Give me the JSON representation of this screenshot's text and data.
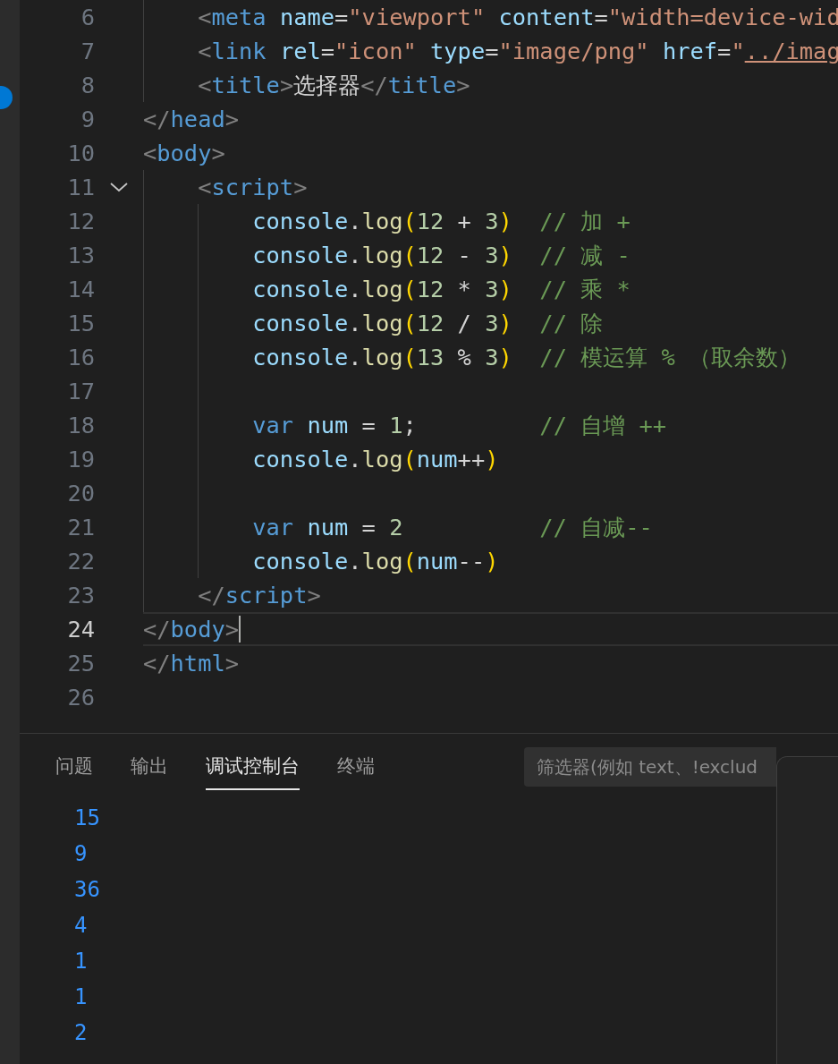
{
  "editor": {
    "lines": [
      {
        "number": "6",
        "selected": false,
        "tokens": [
          {
            "text": "    <",
            "kind": "punct"
          },
          {
            "text": "meta",
            "kind": "tag"
          },
          {
            "text": " name",
            "kind": "attr"
          },
          {
            "text": "=",
            "kind": "text"
          },
          {
            "text": "\"viewport\"",
            "kind": "string"
          },
          {
            "text": " content",
            "kind": "attr"
          },
          {
            "text": "=",
            "kind": "text"
          },
          {
            "text": "\"width=device-wid",
            "kind": "string"
          }
        ]
      },
      {
        "number": "7",
        "selected": false,
        "tokens": [
          {
            "text": "    <",
            "kind": "punct"
          },
          {
            "text": "link",
            "kind": "tag"
          },
          {
            "text": " rel",
            "kind": "attr"
          },
          {
            "text": "=",
            "kind": "text"
          },
          {
            "text": "\"icon\"",
            "kind": "string"
          },
          {
            "text": " type",
            "kind": "attr"
          },
          {
            "text": "=",
            "kind": "text"
          },
          {
            "text": "\"image/png\"",
            "kind": "string"
          },
          {
            "text": " href",
            "kind": "attr"
          },
          {
            "text": "=",
            "kind": "text"
          },
          {
            "text": "\"",
            "kind": "string"
          },
          {
            "text": "../imag",
            "kind": "link"
          }
        ]
      },
      {
        "number": "8",
        "selected": false,
        "tokens": [
          {
            "text": "    <",
            "kind": "punct"
          },
          {
            "text": "title",
            "kind": "tag"
          },
          {
            "text": ">",
            "kind": "punct"
          },
          {
            "text": "选择器",
            "kind": "text"
          },
          {
            "text": "</",
            "kind": "punct"
          },
          {
            "text": "title",
            "kind": "tag"
          },
          {
            "text": ">",
            "kind": "punct"
          }
        ]
      },
      {
        "number": "9",
        "selected": false,
        "tokens": [
          {
            "text": "</",
            "kind": "punct"
          },
          {
            "text": "head",
            "kind": "tag"
          },
          {
            "text": ">",
            "kind": "punct"
          }
        ]
      },
      {
        "number": "10",
        "selected": false,
        "tokens": [
          {
            "text": "<",
            "kind": "punct"
          },
          {
            "text": "body",
            "kind": "tag"
          },
          {
            "text": ">",
            "kind": "punct"
          }
        ]
      },
      {
        "number": "11",
        "selected": false,
        "expanded": true,
        "tokens": [
          {
            "text": "    <",
            "kind": "punct"
          },
          {
            "text": "script",
            "kind": "tag"
          },
          {
            "text": ">",
            "kind": "punct"
          }
        ]
      },
      {
        "number": "12",
        "selected": false,
        "tokens": [
          {
            "text": "        console",
            "kind": "var"
          },
          {
            "text": ".",
            "kind": "text"
          },
          {
            "text": "log",
            "kind": "func"
          },
          {
            "text": "(",
            "kind": "paren"
          },
          {
            "text": "12",
            "kind": "number"
          },
          {
            "text": " + ",
            "kind": "text"
          },
          {
            "text": "3",
            "kind": "number"
          },
          {
            "text": ")",
            "kind": "paren"
          },
          {
            "text": "  // 加 +",
            "kind": "comment"
          }
        ]
      },
      {
        "number": "13",
        "selected": false,
        "tokens": [
          {
            "text": "        console",
            "kind": "var"
          },
          {
            "text": ".",
            "kind": "text"
          },
          {
            "text": "log",
            "kind": "func"
          },
          {
            "text": "(",
            "kind": "paren"
          },
          {
            "text": "12",
            "kind": "number"
          },
          {
            "text": " - ",
            "kind": "text"
          },
          {
            "text": "3",
            "kind": "number"
          },
          {
            "text": ")",
            "kind": "paren"
          },
          {
            "text": "  // 减 -",
            "kind": "comment"
          }
        ]
      },
      {
        "number": "14",
        "selected": false,
        "tokens": [
          {
            "text": "        console",
            "kind": "var"
          },
          {
            "text": ".",
            "kind": "text"
          },
          {
            "text": "log",
            "kind": "func"
          },
          {
            "text": "(",
            "kind": "paren"
          },
          {
            "text": "12",
            "kind": "number"
          },
          {
            "text": " * ",
            "kind": "text"
          },
          {
            "text": "3",
            "kind": "number"
          },
          {
            "text": ")",
            "kind": "paren"
          },
          {
            "text": "  // 乘 *",
            "kind": "comment"
          }
        ]
      },
      {
        "number": "15",
        "selected": false,
        "tokens": [
          {
            "text": "        console",
            "kind": "var"
          },
          {
            "text": ".",
            "kind": "text"
          },
          {
            "text": "log",
            "kind": "func"
          },
          {
            "text": "(",
            "kind": "paren"
          },
          {
            "text": "12",
            "kind": "number"
          },
          {
            "text": " / ",
            "kind": "text"
          },
          {
            "text": "3",
            "kind": "number"
          },
          {
            "text": ")",
            "kind": "paren"
          },
          {
            "text": "  // 除",
            "kind": "comment"
          }
        ]
      },
      {
        "number": "16",
        "selected": false,
        "tokens": [
          {
            "text": "        console",
            "kind": "var"
          },
          {
            "text": ".",
            "kind": "text"
          },
          {
            "text": "log",
            "kind": "func"
          },
          {
            "text": "(",
            "kind": "paren"
          },
          {
            "text": "13",
            "kind": "number"
          },
          {
            "text": " % ",
            "kind": "text"
          },
          {
            "text": "3",
            "kind": "number"
          },
          {
            "text": ")",
            "kind": "paren"
          },
          {
            "text": "  // 模运算 % （取余数）",
            "kind": "comment"
          }
        ]
      },
      {
        "number": "17",
        "selected": false
      },
      {
        "number": "18",
        "selected": false,
        "tokens": [
          {
            "text": "        var",
            "kind": "keyword"
          },
          {
            "text": " num",
            "kind": "var"
          },
          {
            "text": " = ",
            "kind": "text"
          },
          {
            "text": "1",
            "kind": "number"
          },
          {
            "text": ";",
            "kind": "text"
          },
          {
            "text": "         // 自增 ++",
            "kind": "comment"
          }
        ]
      },
      {
        "number": "19",
        "selected": false,
        "tokens": [
          {
            "text": "        console",
            "kind": "var"
          },
          {
            "text": ".",
            "kind": "text"
          },
          {
            "text": "log",
            "kind": "func"
          },
          {
            "text": "(",
            "kind": "paren"
          },
          {
            "text": "num",
            "kind": "var"
          },
          {
            "text": "++",
            "kind": "text"
          },
          {
            "text": ")",
            "kind": "paren"
          }
        ]
      },
      {
        "number": "20",
        "selected": false
      },
      {
        "number": "21",
        "selected": false,
        "tokens": [
          {
            "text": "        var",
            "kind": "keyword"
          },
          {
            "text": " num",
            "kind": "var"
          },
          {
            "text": " = ",
            "kind": "text"
          },
          {
            "text": "2",
            "kind": "number"
          },
          {
            "text": "          // 自减--",
            "kind": "comment"
          }
        ]
      },
      {
        "number": "22",
        "selected": false,
        "tokens": [
          {
            "text": "        console",
            "kind": "var"
          },
          {
            "text": ".",
            "kind": "text"
          },
          {
            "text": "log",
            "kind": "func"
          },
          {
            "text": "(",
            "kind": "paren"
          },
          {
            "text": "num",
            "kind": "var"
          },
          {
            "text": "--",
            "kind": "text"
          },
          {
            "text": ")",
            "kind": "paren"
          }
        ]
      },
      {
        "number": "23",
        "selected": false,
        "tokens": [
          {
            "text": "    </",
            "kind": "punct"
          },
          {
            "text": "script",
            "kind": "tag"
          },
          {
            "text": ">",
            "kind": "punct"
          }
        ]
      },
      {
        "number": "24",
        "selected": true,
        "tokens": [
          {
            "text": "</",
            "kind": "punct"
          },
          {
            "text": "body",
            "kind": "tag"
          },
          {
            "text": ">",
            "kind": "punct"
          }
        ]
      },
      {
        "number": "25",
        "selected": false,
        "tokens": [
          {
            "text": "</",
            "kind": "punct"
          },
          {
            "text": "html",
            "kind": "tag"
          },
          {
            "text": ">",
            "kind": "punct"
          }
        ]
      },
      {
        "number": "26",
        "selected": false
      }
    ]
  },
  "panel": {
    "tabs": [
      {
        "label": "问题",
        "selected": false
      },
      {
        "label": "输出",
        "selected": false
      },
      {
        "label": "调试控制台",
        "selected": true
      },
      {
        "label": "终端",
        "selected": false
      }
    ],
    "filter": {
      "placeholder": "筛选器(例如 text、!exclud"
    },
    "output": [
      "15",
      "9",
      "36",
      "4",
      "1",
      "1",
      "2"
    ]
  }
}
